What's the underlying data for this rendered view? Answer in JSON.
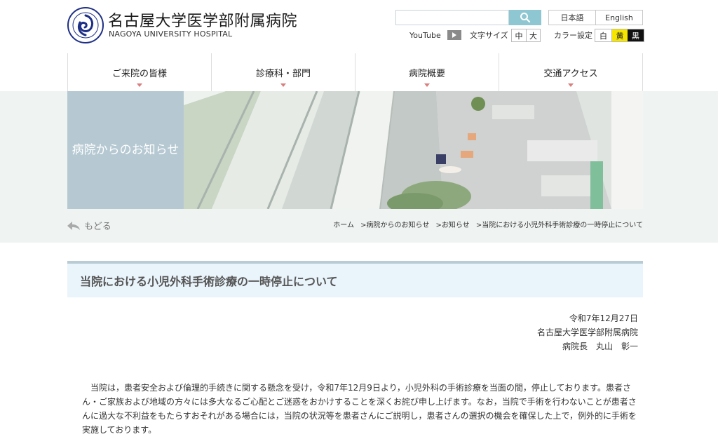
{
  "header": {
    "title": "名古屋大学医学部附属病院",
    "subtitle": "NAGOYA UNIVERSITY HOSPITAL",
    "logo_icon": "university-seal-icon",
    "search": {
      "value": "",
      "placeholder": ""
    },
    "lang": {
      "ja": "日本語",
      "en": "English"
    },
    "youtube_label": "YouTube",
    "font_size": {
      "label": "文字サイズ",
      "medium": "中",
      "large": "大"
    },
    "color": {
      "label": "カラー設定",
      "white": "白",
      "yellow": "黄",
      "black": "黒"
    }
  },
  "nav": {
    "items": [
      {
        "label": "ご来院の皆様"
      },
      {
        "label": "診療科・部門"
      },
      {
        "label": "病院概要"
      },
      {
        "label": "交通アクセス"
      }
    ]
  },
  "section": {
    "label": "病院からのお知らせ"
  },
  "back": {
    "label": "もどる"
  },
  "breadcrumb": [
    "ホーム",
    ">病院からのお知らせ",
    ">お知らせ",
    ">当院における小児外科手術診療の一時停止について"
  ],
  "article": {
    "title": "当院における小児外科手術診療の一時停止について",
    "date": "令和7年12月27日",
    "organization": "名古屋大学医学部附属病院",
    "signer": "病院長　丸山　彰一",
    "body": "当院は，患者安全および倫理的手続きに関する懸念を受け，令和7年12月9日より，小児外科の手術診療を当面の間，停止しております。患者さん・ご家族および地域の方々には多大なるご心配とご迷惑をおかけすることを深くお詫び申し上げます。なお，当院で手術を行わないことが患者さんに過大な不利益をもたらすおそれがある場合には，当院の状況等を患者さんにご説明し，患者さんの選択の機会を確保した上で，例外的に手術を実施しております。"
  },
  "colors": {
    "accent": "#8ec7d2",
    "section_box": "#b6c9d2",
    "title_band": "#eaf4fb",
    "caret": "#d9807f",
    "logo": "#1e2f86"
  }
}
